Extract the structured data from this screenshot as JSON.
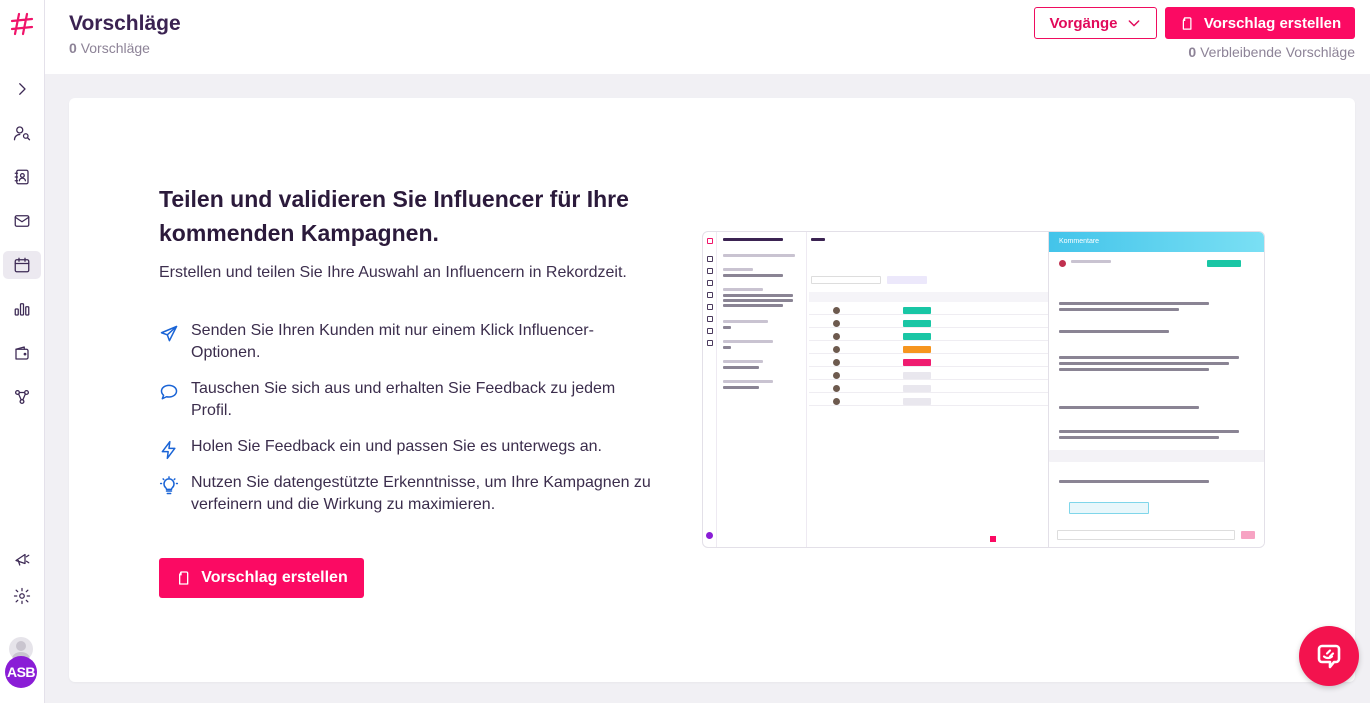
{
  "sidebar": {
    "logo": "hashtag-logo",
    "items": [
      {
        "name": "expand-icon"
      },
      {
        "name": "influencer-search-icon"
      },
      {
        "name": "contacts-icon"
      },
      {
        "name": "mail-icon"
      },
      {
        "name": "calendar-icon",
        "active": true
      },
      {
        "name": "analytics-icon"
      },
      {
        "name": "wallet-icon"
      },
      {
        "name": "workflow-icon"
      },
      {
        "name": "announcements-icon"
      },
      {
        "name": "settings-icon"
      }
    ],
    "avatar_initials": "ASB"
  },
  "header": {
    "title": "Vorschläge",
    "count": "0",
    "count_label": "Vorschläge",
    "processes_label": "Vorgänge",
    "create_label": "Vorschlag erstellen",
    "remaining_count": "0",
    "remaining_label": "Verbleibende Vorschläge"
  },
  "hero": {
    "title": "Teilen und validieren Sie Influencer für Ihre kommenden Kampagnen.",
    "subtitle": "Erstellen und teilen Sie Ihre Auswahl an Influencern in Rekordzeit.",
    "features": [
      {
        "icon": "send-icon",
        "text": "Senden Sie Ihren Kunden mit nur einem Klick Influencer-Optionen."
      },
      {
        "icon": "chat-icon",
        "text": "Tauschen Sie sich aus und erhalten Sie Feedback zu jedem Profil."
      },
      {
        "icon": "lightning-icon",
        "text": "Holen Sie Feedback ein und passen Sie es unterwegs an."
      },
      {
        "icon": "lightbulb-icon",
        "text": "Nutzen Sie datengestützte Erkenntnisse, um Ihre Kampagnen zu verfeinern und die Wirkung zu maximieren."
      }
    ],
    "cta_label": "Vorschlag erstellen"
  },
  "preview": {
    "comments_title": "Kommentare"
  },
  "colors": {
    "brand_pink": "#fb0a63",
    "brand_purple": "#3b2352",
    "feature_icon_blue": "#1a64d6"
  }
}
